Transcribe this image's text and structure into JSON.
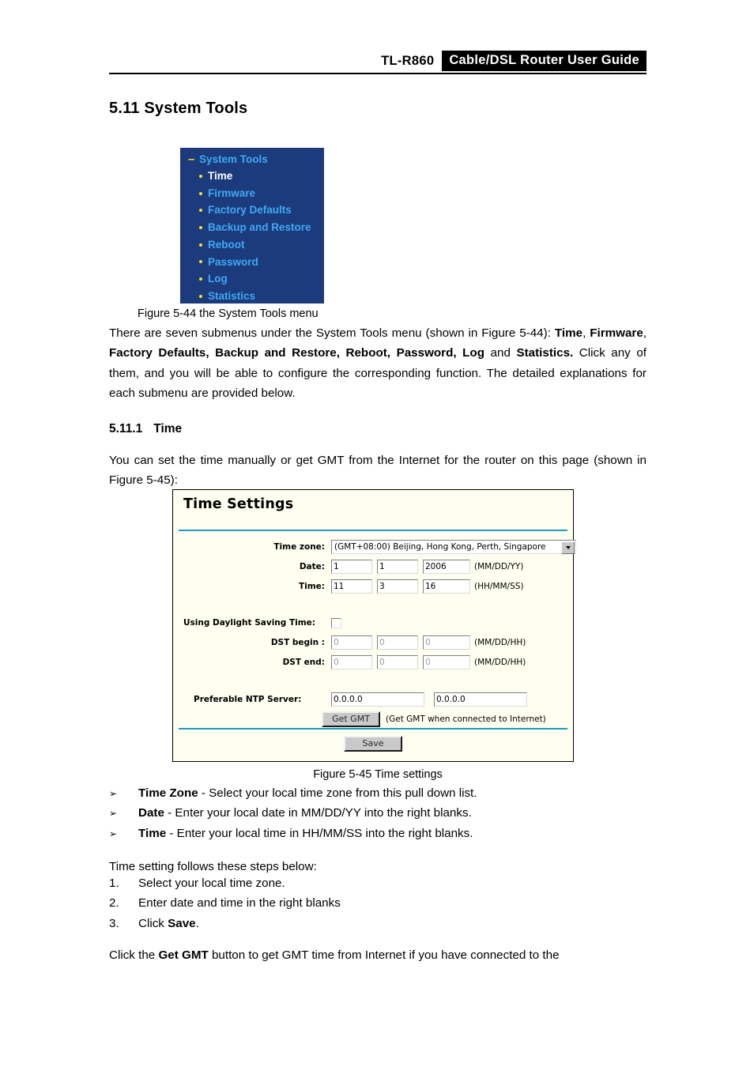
{
  "header": {
    "model": "TL-R860",
    "title": "Cable/DSL  Router  User  Guide"
  },
  "section": {
    "heading": "5.11 System Tools",
    "sub_number": "5.11.1",
    "sub_title": "Time"
  },
  "menu_figure": {
    "root_label": "System Tools",
    "minus_glyph": "–",
    "items": [
      {
        "label": "Time",
        "selected": true
      },
      {
        "label": "Firmware",
        "selected": false
      },
      {
        "label": "Factory Defaults",
        "selected": false
      },
      {
        "label": "Backup and Restore",
        "selected": false
      },
      {
        "label": "Reboot",
        "selected": false
      },
      {
        "label": "Password",
        "selected": false
      },
      {
        "label": "Log",
        "selected": false
      },
      {
        "label": "Statistics",
        "selected": false
      }
    ],
    "colors": {
      "background": "#1b3b7c",
      "link": "#3fa9f5",
      "selected": "#ffffff",
      "bullet": "#f7dd30"
    }
  },
  "captions": {
    "fig_544": "Figure 5-44 the System Tools menu",
    "fig_545": "Figure 5-45 Time settings"
  },
  "paragraphs": {
    "intro_html": "There are seven submenus under the System Tools menu (shown in Figure 5-44): <b>Time</b>, <b>Firmware</b>, <b>Factory Defaults, Backup and Restore, Reboot, Password, Log</b> and <b>Statistics.</b> Click any of them, and you will be able to configure the corresponding function. The detailed explanations for each submenu are provided below.",
    "time_intro_html": "You can set the time manually or get GMT from the Internet for the router on this page (shown in Figure 5-45):",
    "steps_intro": "Time setting follows these steps below:",
    "closing_html": "Click the <b>Get GMT</b> button to get GMT time from Internet if you have connected to the"
  },
  "bullets": {
    "glyph": "➢",
    "items": [
      {
        "term": "Time Zone",
        "rest": " - Select your local time zone from this pull down list."
      },
      {
        "term": "Date",
        "rest": " - Enter your local date in MM/DD/YY into the right blanks."
      },
      {
        "term": "Time",
        "rest": " - Enter your local time in HH/MM/SS into the right blanks."
      }
    ]
  },
  "steps": [
    {
      "marker": "1.",
      "text_html": "Select your local time zone."
    },
    {
      "marker": "2.",
      "text_html": "Enter date and time in the right blanks"
    },
    {
      "marker": "3.",
      "text_html": "Click <b>Save</b>."
    }
  ],
  "time_settings": {
    "panel_title": "Time Settings",
    "rule_color": "#1f9bc4",
    "panel_background": "#fefff0",
    "time_zone": {
      "label": "Time zone:",
      "value": "(GMT+08:00) Beijing, Hong Kong, Perth, Singapore"
    },
    "date": {
      "label": "Date:",
      "month": "1",
      "day": "1",
      "year": "2006",
      "format": "(MM/DD/YY)"
    },
    "time": {
      "label": "Time:",
      "hour": "11",
      "minute": "3",
      "second": "16",
      "format": "(HH/MM/SS)"
    },
    "dst_toggle": {
      "label": "Using Daylight Saving Time:",
      "checked": false
    },
    "dst_begin": {
      "label": "DST begin :",
      "month": "0",
      "day": "0",
      "hour": "0",
      "format": "(MM/DD/HH)"
    },
    "dst_end": {
      "label": "DST end:",
      "month": "0",
      "day": "0",
      "hour": "0",
      "format": "(MM/DD/HH)"
    },
    "ntp": {
      "label": "Preferable NTP Server:",
      "primary": "0.0.0.0",
      "secondary": "0.0.0.0"
    },
    "get_gmt": {
      "label": "Get GMT",
      "note": "(Get GMT when connected to Internet)"
    },
    "save": {
      "label": "Save"
    }
  }
}
